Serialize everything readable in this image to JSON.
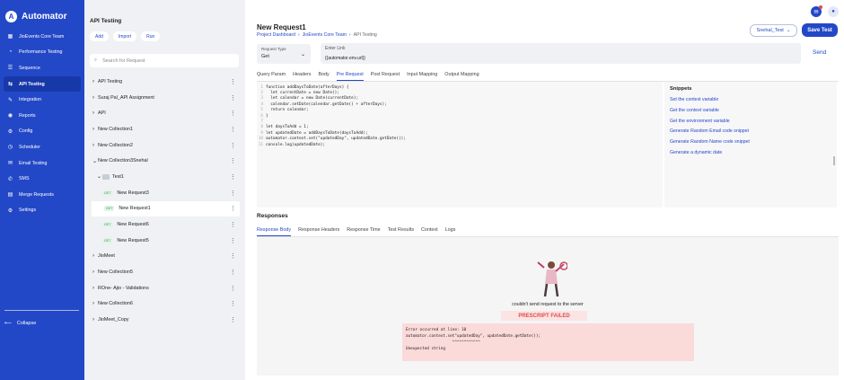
{
  "app": {
    "name": "Automator"
  },
  "sidebar": {
    "items": [
      {
        "label": "JioEvents Core Team",
        "icon": "team-icon",
        "active": false
      },
      {
        "label": "Performance Testing",
        "icon": "speed-icon",
        "active": false
      },
      {
        "label": "Sequence",
        "icon": "list-icon",
        "active": false
      },
      {
        "label": "API Testing",
        "icon": "api-icon",
        "active": true
      },
      {
        "label": "Integration",
        "icon": "wrench-icon",
        "active": false
      },
      {
        "label": "Reports",
        "icon": "report-icon",
        "active": false
      },
      {
        "label": "Config",
        "icon": "gear-icon",
        "active": false
      },
      {
        "label": "Scheduler",
        "icon": "clock-icon",
        "active": false
      },
      {
        "label": "Email Testing",
        "icon": "mail-icon",
        "active": false
      },
      {
        "label": "SMS",
        "icon": "sms-icon",
        "active": false
      },
      {
        "label": "Merge Requests",
        "icon": "merge-icon",
        "active": false
      },
      {
        "label": "Settings",
        "icon": "settings-icon",
        "active": false
      }
    ],
    "collapse_label": "Collapse"
  },
  "tree": {
    "title": "API Testing",
    "actions": [
      "Add",
      "Import",
      "Run"
    ],
    "search_placeholder": "Search for Request",
    "nodes": [
      {
        "label": "API Testing",
        "level": 1,
        "type": "collection",
        "chev": "›"
      },
      {
        "label": "Suraj Pal_API Assignment",
        "level": 1,
        "type": "collection",
        "chev": "›"
      },
      {
        "label": "API",
        "level": 1,
        "type": "collection",
        "chev": "›"
      },
      {
        "label": "New Collection1",
        "level": 1,
        "type": "collection",
        "chev": "›"
      },
      {
        "label": "New Collection2",
        "level": 1,
        "type": "collection",
        "chev": "›"
      },
      {
        "label": "New Collection3Snehal",
        "level": 1,
        "type": "collection",
        "chev": "⌄"
      },
      {
        "label": "Test1",
        "level": 3,
        "type": "folder",
        "chev": "⌄"
      },
      {
        "label": "New Request3",
        "level": 2,
        "type": "request",
        "method": "GET"
      },
      {
        "label": "New Request1",
        "level": 2,
        "type": "request",
        "method": "GET",
        "selected": true
      },
      {
        "label": "New Request6",
        "level": 2,
        "type": "request",
        "method": "GET"
      },
      {
        "label": "New Request5",
        "level": 2,
        "type": "request",
        "method": "GET"
      },
      {
        "label": "JioMeet",
        "level": 1,
        "type": "collection",
        "chev": "›"
      },
      {
        "label": "New Collection5",
        "level": 1,
        "type": "collection",
        "chev": "›"
      },
      {
        "label": "ROne- Ajio - Validations",
        "level": 1,
        "type": "collection",
        "chev": "›"
      },
      {
        "label": "New Collection6",
        "level": 1,
        "type": "collection",
        "chev": "›"
      },
      {
        "label": "JioMeet_Copy",
        "level": 1,
        "type": "collection",
        "chev": "›"
      }
    ]
  },
  "request": {
    "title": "New Request1",
    "breadcrumb": [
      "Project Dashboard",
      "JioEvents Core Team",
      "API Testing"
    ],
    "environment": "Snehal_Test",
    "save_label": "Save Test",
    "type_label": "Request Type",
    "type_value": "Get",
    "link_label": "Enter Link",
    "link_value": "{{automator.env.url}}",
    "send_label": "Send"
  },
  "tabs": [
    "Query Param",
    "Headers",
    "Body",
    "Pre Request",
    "Post Request",
    "Input Mapping",
    "Output Mapping"
  ],
  "active_tab": "Pre Request",
  "code": [
    "function addDaysToDate(afterDays) {",
    "  let currentDate = new Date();",
    "  let calendar = new Date(currentDate);",
    "  calendar.setDate(calendar.getDate() + afterDays);",
    "  return calendar;",
    "}",
    "",
    "let daysToAdd = 1;",
    "let updatedDate = addDaysToDate(daysToAdd);",
    "automator.context.set(\"updatedDay\", updatedDate.getDate());",
    "console.log(updatedDate);"
  ],
  "snippets": {
    "title": "Snippets",
    "items": [
      "Set the context variable",
      "Get the context variable",
      "Get the environment variable",
      "Generate Random Email code snippet",
      "Generate Random Name code snippet",
      "Generate a dynamic date"
    ]
  },
  "responses": {
    "title": "Responses",
    "tabs": [
      "Response Body",
      "Response Headers",
      "Response Time",
      "Test Results",
      "Context",
      "Logs"
    ],
    "message": "couldn't send request to the server",
    "status": "PRESCRIPT FAILED",
    "error_lines": [
      "Error occurred at line: 10",
      "automator.context.set\"updatedDay\", updatedDate.getDate());",
      "                    ^^^^^^^^^^^^",
      "Unexpected string"
    ]
  },
  "colors": {
    "primary": "#2348c7",
    "error": "#e24a4a"
  }
}
